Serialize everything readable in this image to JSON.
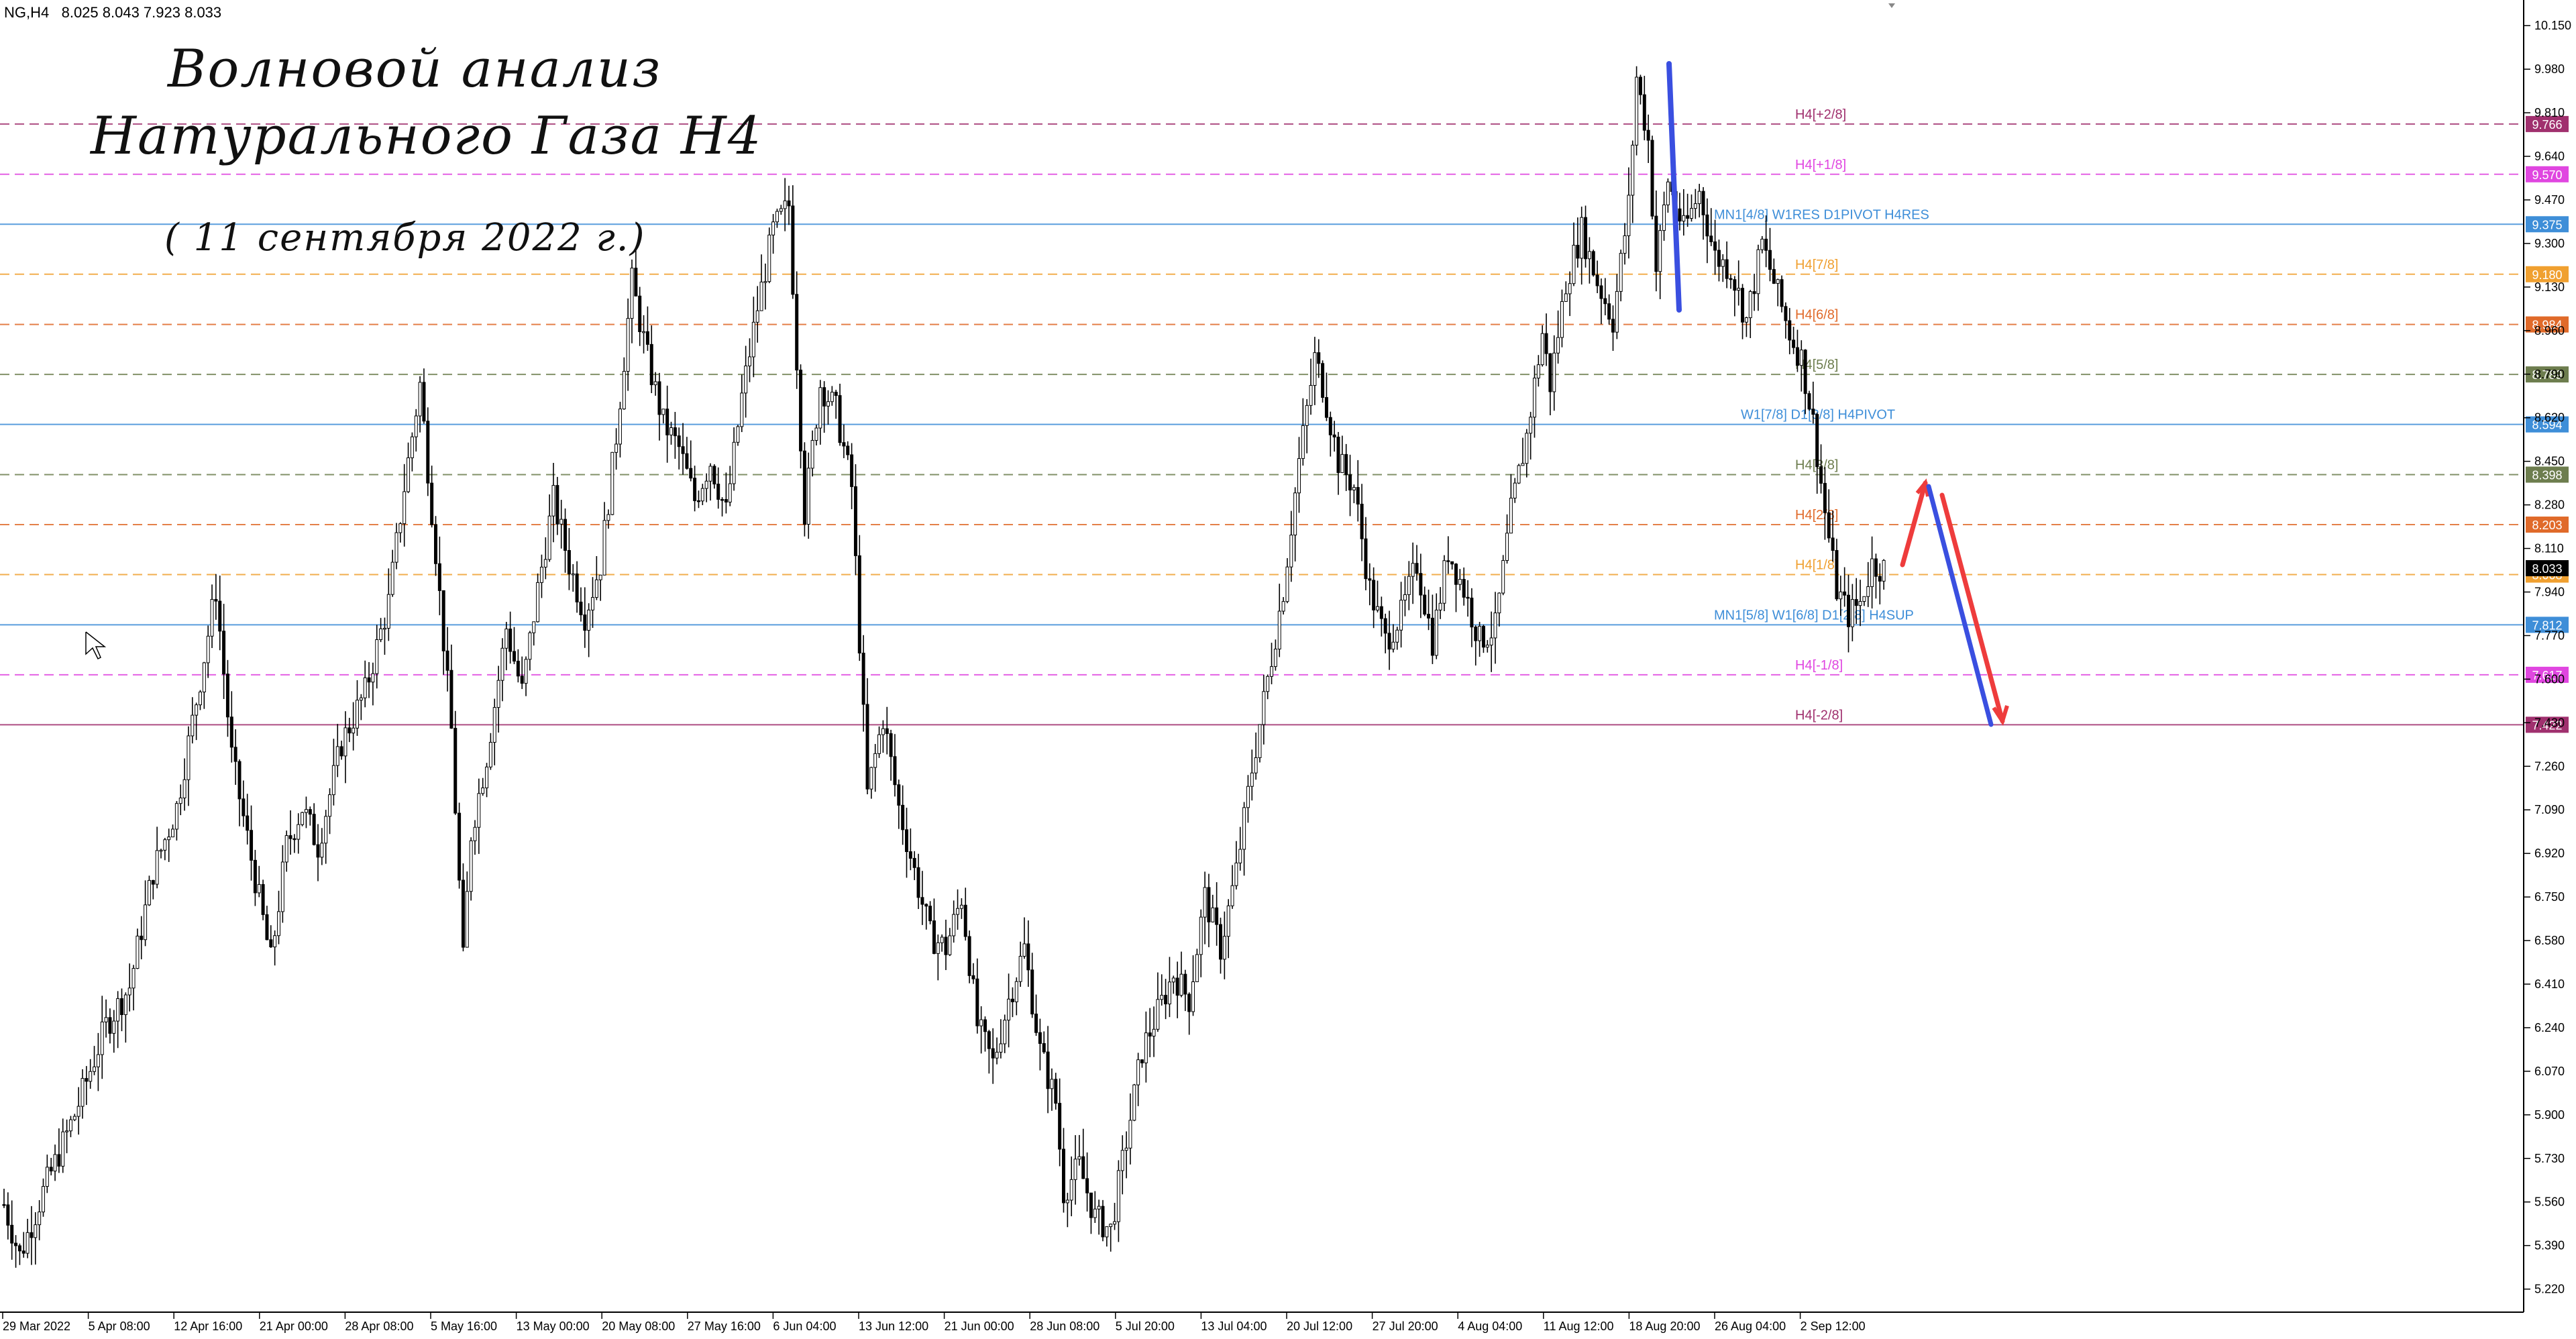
{
  "header": {
    "symbol": "NG,H4",
    "ohlc": "8.025 8.043 7.923 8.033"
  },
  "overlay": {
    "title_line1": "Волновой анализ",
    "title_line2": "Натурального Газа H4",
    "date_line": "( 11 сентября 2022 г.)"
  },
  "chart_data": {
    "type": "candlestick",
    "ylim": [
      5.13,
      10.25
    ],
    "y_ticks": [
      "10.150",
      "9.980",
      "9.810",
      "9.640",
      "9.470",
      "9.300",
      "9.130",
      "8.960",
      "8.790",
      "8.620",
      "8.450",
      "8.280",
      "8.110",
      "7.940",
      "7.770",
      "7.600",
      "7.430",
      "7.260",
      "7.090",
      "6.920",
      "6.750",
      "6.580",
      "6.410",
      "6.240",
      "6.070",
      "5.900",
      "5.730",
      "5.560",
      "5.390",
      "5.220"
    ],
    "x_ticks": [
      "29 Mar 2022",
      "5 Apr 08:00",
      "12 Apr 16:00",
      "21 Apr 00:00",
      "28 Apr 08:00",
      "5 May 16:00",
      "13 May 00:00",
      "20 May 08:00",
      "27 May 16:00",
      "6 Jun 04:00",
      "13 Jun 12:00",
      "21 Jun 00:00",
      "28 Jun 08:00",
      "5 Jul 20:00",
      "13 Jul 04:00",
      "20 Jul 12:00",
      "27 Jul 20:00",
      "4 Aug 04:00",
      "11 Aug 12:00",
      "18 Aug 20:00",
      "26 Aug 04:00",
      "2 Sep 12:00"
    ],
    "price_path": [
      [
        0,
        5.55
      ],
      [
        4,
        5.35
      ],
      [
        10,
        5.6
      ],
      [
        18,
        5.9
      ],
      [
        26,
        6.25
      ],
      [
        32,
        6.4
      ],
      [
        38,
        6.85
      ],
      [
        44,
        7.1
      ],
      [
        50,
        7.6
      ],
      [
        54,
        7.95
      ],
      [
        58,
        7.3
      ],
      [
        63,
        6.9
      ],
      [
        68,
        6.5
      ],
      [
        72,
        6.95
      ],
      [
        76,
        7.1
      ],
      [
        80,
        6.95
      ],
      [
        86,
        7.35
      ],
      [
        92,
        7.55
      ],
      [
        98,
        7.9
      ],
      [
        102,
        8.35
      ],
      [
        106,
        8.75
      ],
      [
        110,
        8.1
      ],
      [
        114,
        7.4
      ],
      [
        117,
        6.5
      ],
      [
        119,
        7.0
      ],
      [
        123,
        7.3
      ],
      [
        128,
        7.8
      ],
      [
        132,
        7.55
      ],
      [
        136,
        7.95
      ],
      [
        140,
        8.3
      ],
      [
        144,
        8.05
      ],
      [
        148,
        7.85
      ],
      [
        152,
        8.05
      ],
      [
        156,
        8.55
      ],
      [
        160,
        9.15
      ],
      [
        164,
        8.85
      ],
      [
        168,
        8.6
      ],
      [
        172,
        8.5
      ],
      [
        176,
        8.3
      ],
      [
        180,
        8.45
      ],
      [
        184,
        8.25
      ],
      [
        188,
        8.7
      ],
      [
        192,
        9.05
      ],
      [
        196,
        9.35
      ],
      [
        200,
        9.45
      ],
      [
        204,
        8.25
      ],
      [
        208,
        8.75
      ],
      [
        212,
        8.65
      ],
      [
        216,
        8.35
      ],
      [
        220,
        7.15
      ],
      [
        224,
        7.45
      ],
      [
        228,
        7.1
      ],
      [
        232,
        6.85
      ],
      [
        236,
        6.6
      ],
      [
        240,
        6.55
      ],
      [
        244,
        6.75
      ],
      [
        248,
        6.25
      ],
      [
        252,
        6.1
      ],
      [
        256,
        6.35
      ],
      [
        260,
        6.55
      ],
      [
        264,
        6.15
      ],
      [
        268,
        5.95
      ],
      [
        270,
        5.6
      ],
      [
        274,
        5.7
      ],
      [
        278,
        5.5
      ],
      [
        282,
        5.45
      ],
      [
        286,
        5.8
      ],
      [
        290,
        6.15
      ],
      [
        294,
        6.3
      ],
      [
        298,
        6.45
      ],
      [
        302,
        6.35
      ],
      [
        306,
        6.75
      ],
      [
        310,
        6.55
      ],
      [
        314,
        6.85
      ],
      [
        318,
        7.25
      ],
      [
        322,
        7.6
      ],
      [
        326,
        7.95
      ],
      [
        330,
        8.45
      ],
      [
        334,
        8.85
      ],
      [
        336,
        8.75
      ],
      [
        340,
        8.45
      ],
      [
        344,
        8.35
      ],
      [
        348,
        7.95
      ],
      [
        352,
        7.75
      ],
      [
        356,
        7.85
      ],
      [
        360,
        8.05
      ],
      [
        364,
        7.75
      ],
      [
        368,
        8.1
      ],
      [
        372,
        7.95
      ],
      [
        376,
        7.75
      ],
      [
        380,
        7.8
      ],
      [
        384,
        8.25
      ],
      [
        388,
        8.55
      ],
      [
        392,
        8.95
      ],
      [
        394,
        8.75
      ],
      [
        398,
        9.15
      ],
      [
        402,
        9.35
      ],
      [
        406,
        9.15
      ],
      [
        410,
        9.0
      ],
      [
        414,
        9.45
      ],
      [
        416,
        9.95
      ],
      [
        419,
        9.7
      ],
      [
        421,
        9.2
      ],
      [
        424,
        9.55
      ],
      [
        428,
        9.35
      ],
      [
        432,
        9.5
      ],
      [
        436,
        9.25
      ],
      [
        440,
        9.2
      ],
      [
        444,
        9.0
      ],
      [
        448,
        9.3
      ],
      [
        452,
        9.1
      ],
      [
        455,
        8.95
      ],
      [
        458,
        8.85
      ],
      [
        461,
        8.6
      ],
      [
        464,
        8.25
      ],
      [
        467,
        7.95
      ],
      [
        470,
        7.85
      ],
      [
        473,
        7.9
      ],
      [
        476,
        8.05
      ],
      [
        479,
        8.03
      ]
    ]
  },
  "levels": [
    {
      "value": "9.766",
      "label": "H4[+2/8]",
      "color": "#a0306e",
      "dash": true
    },
    {
      "value": "9.570",
      "label": "H4[+1/8]",
      "color": "#e046e0",
      "dash": true
    },
    {
      "value": "9.375",
      "label": "MN1[4/8] W1RES D1PIVOT H4RES",
      "color": "#3e8ed8",
      "dash": false
    },
    {
      "value": "9.180",
      "label": "H4[7/8]",
      "color": "#f0a030",
      "dash": true
    },
    {
      "value": "8.984",
      "label": "H4[6/8]",
      "color": "#e06a2a",
      "dash": true
    },
    {
      "value": "8.789",
      "label": "H4[5/8]",
      "color": "#6d7d4e",
      "dash": true
    },
    {
      "value": "8.594",
      "label": "W1[7/8] D1[3/8] H4PIVOT",
      "color": "#3e8ed8",
      "dash": false
    },
    {
      "value": "8.398",
      "label": "H4[3/8]",
      "color": "#6d7d4e",
      "dash": true
    },
    {
      "value": "8.203",
      "label": "H4[2/8]",
      "color": "#e06a2a",
      "dash": true
    },
    {
      "value": "8.008",
      "label": "H4[1/8]",
      "color": "#f0a030",
      "dash": true
    },
    {
      "value": "7.812",
      "label": "MN1[5/8] W1[6/8] D1[2/8] H4SUP",
      "color": "#3e8ed8",
      "dash": false
    },
    {
      "value": "7.617",
      "label": "H4[-1/8]",
      "color": "#e046e0",
      "dash": true
    },
    {
      "value": "7.422",
      "label": "H4[-2/8]",
      "color": "#a0306e",
      "dash": false
    }
  ],
  "current_price": {
    "value": "8.033",
    "color": "#000000"
  },
  "colors": {
    "candle": "#000000",
    "blue_arrow": "#3a4fe0",
    "red_arrow": "#ee3c3c",
    "axis": "#000000"
  }
}
